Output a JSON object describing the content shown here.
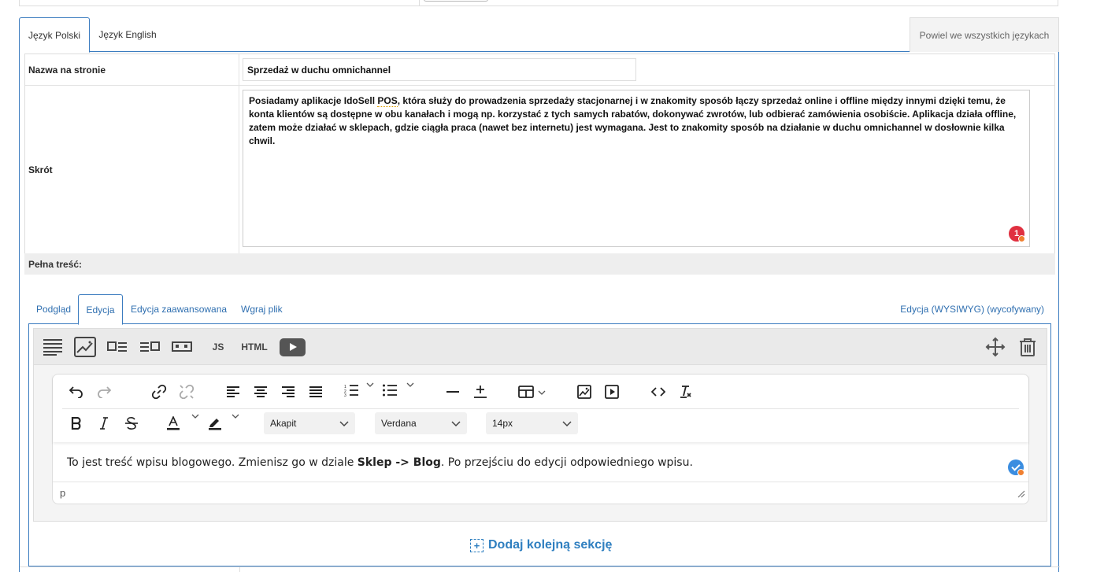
{
  "language_tabs": {
    "polish": "Język Polski",
    "english": "Język English",
    "copy_all": "Powiel we wszystkich językach"
  },
  "form": {
    "name_label": "Nazwa na stronie",
    "name_value": "Sprzedaż w duchu omnichannel",
    "shortcut_label": "Skrót",
    "shortcut_text_pre": "Posiadamy aplikacje IdoSell ",
    "shortcut_text_pos": "POS",
    "shortcut_text_post": ", która służy do prowadzenia sprzedaży stacjonarnej i w znakomity sposób łączy sprzedaż online i offline między innymi dzięki temu, że konta klientów są dostępne w obu kanałach i mogą np. korzystać z tych samych rabatów, dokonywać zwrotów, lub odbierać zamówienia osobiście. Aplikacja działa offline, zatem może działać w sklepach, gdzie ciągła praca (nawet bez internetu) jest wymagana. Jest to znakomity sposób na działanie w duchu omnichannel w dosłownie kilka chwil.",
    "shortcut_badge": "1",
    "full_content_label": "Pełna treść:"
  },
  "content_tabs": {
    "preview": "Podgląd",
    "edit": "Edycja",
    "advanced": "Edycja zaawansowana",
    "upload": "Wgraj plik",
    "wysiwyg": "Edycja (WYSIWYG) (wycofywany)"
  },
  "section_toolbar": {
    "js": "JS",
    "html": "HTML"
  },
  "editor": {
    "block_format": "Akapit",
    "font_family": "Verdana",
    "font_size": "14px",
    "body_pre": "To jest treść wpisu blogowego. Zmienisz go w dziale ",
    "body_bold": "Sklep -> Blog",
    "body_post": ". Po przejściu do edycji odpowiedniego wpisu.",
    "status_path": "p"
  },
  "add_section_label": "Dodaj kolejną sekcję"
}
